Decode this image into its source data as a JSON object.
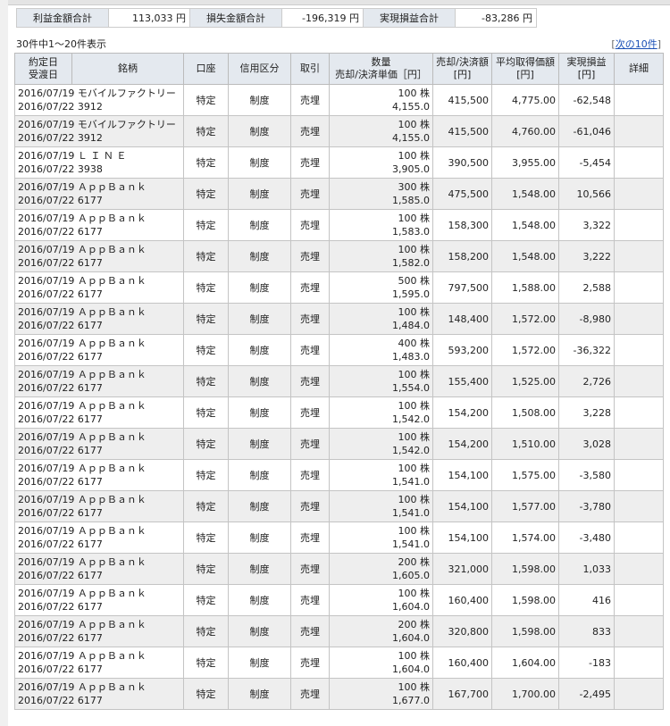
{
  "summary": {
    "profit_label": "利益金額合計",
    "profit": "113,033 円",
    "loss_label": "損失金額合計",
    "loss": "-196,319 円",
    "net_label": "実現損益合計",
    "net": "-83,286 円"
  },
  "pager": {
    "count": "30件中1～20件表示",
    "next": "次の10件"
  },
  "headers": {
    "date1": "約定日",
    "date2": "受渡日",
    "name": "銘柄",
    "account": "口座",
    "credit": "信用区分",
    "trade": "取引",
    "qty": "数量",
    "price": "売却/決済単価［円］",
    "amount1": "売却/決済額",
    "amount2": "[円]",
    "avg1": "平均取得価額",
    "avg2": "[円]",
    "pnl1": "実現損益",
    "pnl2": "[円]",
    "detail": "詳細"
  },
  "rows": [
    [
      "2016/07/19",
      "2016/07/22",
      "モバイルファクトリー",
      "3912",
      "特定",
      "制度",
      "売埋",
      "100 株",
      "4,155.0",
      "415,500",
      "4,775.00",
      "-62,548"
    ],
    [
      "2016/07/19",
      "2016/07/22",
      "モバイルファクトリー",
      "3912",
      "特定",
      "制度",
      "売埋",
      "100 株",
      "4,155.0",
      "415,500",
      "4,760.00",
      "-61,046"
    ],
    [
      "2016/07/19",
      "2016/07/22",
      "Ｌ Ｉ Ｎ Ｅ",
      "3938",
      "特定",
      "制度",
      "売埋",
      "100 株",
      "3,905.0",
      "390,500",
      "3,955.00",
      "-5,454"
    ],
    [
      "2016/07/19",
      "2016/07/22",
      "ＡｐｐＢａｎｋ",
      "6177",
      "特定",
      "制度",
      "売埋",
      "300 株",
      "1,585.0",
      "475,500",
      "1,548.00",
      "10,566"
    ],
    [
      "2016/07/19",
      "2016/07/22",
      "ＡｐｐＢａｎｋ",
      "6177",
      "特定",
      "制度",
      "売埋",
      "100 株",
      "1,583.0",
      "158,300",
      "1,548.00",
      "3,322"
    ],
    [
      "2016/07/19",
      "2016/07/22",
      "ＡｐｐＢａｎｋ",
      "6177",
      "特定",
      "制度",
      "売埋",
      "100 株",
      "1,582.0",
      "158,200",
      "1,548.00",
      "3,222"
    ],
    [
      "2016/07/19",
      "2016/07/22",
      "ＡｐｐＢａｎｋ",
      "6177",
      "特定",
      "制度",
      "売埋",
      "500 株",
      "1,595.0",
      "797,500",
      "1,588.00",
      "2,588"
    ],
    [
      "2016/07/19",
      "2016/07/22",
      "ＡｐｐＢａｎｋ",
      "6177",
      "特定",
      "制度",
      "売埋",
      "100 株",
      "1,484.0",
      "148,400",
      "1,572.00",
      "-8,980"
    ],
    [
      "2016/07/19",
      "2016/07/22",
      "ＡｐｐＢａｎｋ",
      "6177",
      "特定",
      "制度",
      "売埋",
      "400 株",
      "1,483.0",
      "593,200",
      "1,572.00",
      "-36,322"
    ],
    [
      "2016/07/19",
      "2016/07/22",
      "ＡｐｐＢａｎｋ",
      "6177",
      "特定",
      "制度",
      "売埋",
      "100 株",
      "1,554.0",
      "155,400",
      "1,525.00",
      "2,726"
    ],
    [
      "2016/07/19",
      "2016/07/22",
      "ＡｐｐＢａｎｋ",
      "6177",
      "特定",
      "制度",
      "売埋",
      "100 株",
      "1,542.0",
      "154,200",
      "1,508.00",
      "3,228"
    ],
    [
      "2016/07/19",
      "2016/07/22",
      "ＡｐｐＢａｎｋ",
      "6177",
      "特定",
      "制度",
      "売埋",
      "100 株",
      "1,542.0",
      "154,200",
      "1,510.00",
      "3,028"
    ],
    [
      "2016/07/19",
      "2016/07/22",
      "ＡｐｐＢａｎｋ",
      "6177",
      "特定",
      "制度",
      "売埋",
      "100 株",
      "1,541.0",
      "154,100",
      "1,575.00",
      "-3,580"
    ],
    [
      "2016/07/19",
      "2016/07/22",
      "ＡｐｐＢａｎｋ",
      "6177",
      "特定",
      "制度",
      "売埋",
      "100 株",
      "1,541.0",
      "154,100",
      "1,577.00",
      "-3,780"
    ],
    [
      "2016/07/19",
      "2016/07/22",
      "ＡｐｐＢａｎｋ",
      "6177",
      "特定",
      "制度",
      "売埋",
      "100 株",
      "1,541.0",
      "154,100",
      "1,574.00",
      "-3,480"
    ],
    [
      "2016/07/19",
      "2016/07/22",
      "ＡｐｐＢａｎｋ",
      "6177",
      "特定",
      "制度",
      "売埋",
      "200 株",
      "1,605.0",
      "321,000",
      "1,598.00",
      "1,033"
    ],
    [
      "2016/07/19",
      "2016/07/22",
      "ＡｐｐＢａｎｋ",
      "6177",
      "特定",
      "制度",
      "売埋",
      "100 株",
      "1,604.0",
      "160,400",
      "1,598.00",
      "416"
    ],
    [
      "2016/07/19",
      "2016/07/22",
      "ＡｐｐＢａｎｋ",
      "6177",
      "特定",
      "制度",
      "売埋",
      "200 株",
      "1,604.0",
      "320,800",
      "1,598.00",
      "833"
    ],
    [
      "2016/07/19",
      "2016/07/22",
      "ＡｐｐＢａｎｋ",
      "6177",
      "特定",
      "制度",
      "売埋",
      "100 株",
      "1,604.0",
      "160,400",
      "1,604.00",
      "-183"
    ],
    [
      "2016/07/19",
      "2016/07/22",
      "ＡｐｐＢａｎｋ",
      "6177",
      "特定",
      "制度",
      "売埋",
      "100 株",
      "1,677.0",
      "167,700",
      "1,700.00",
      "-2,495"
    ]
  ]
}
